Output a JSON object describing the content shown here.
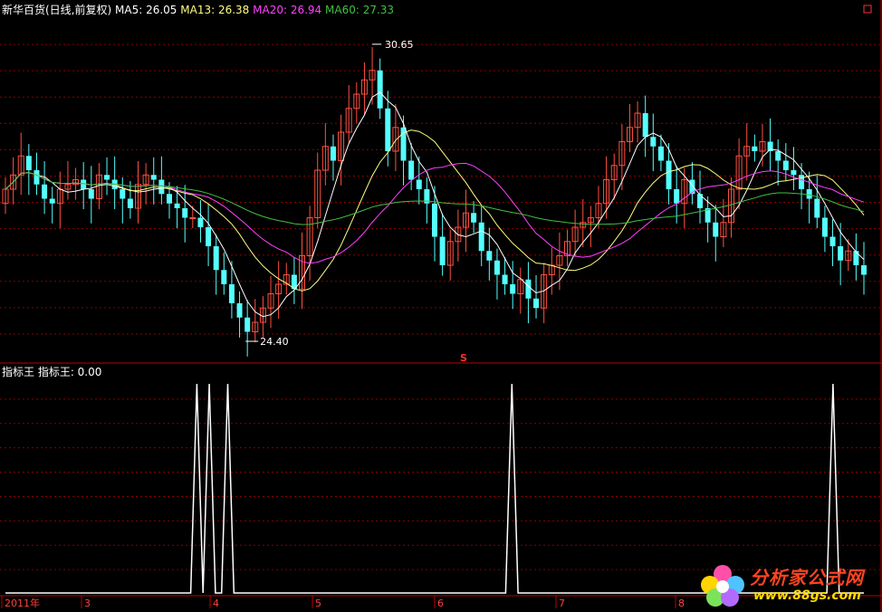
{
  "header": {
    "stock_label": "新华百货(日线,前复权)",
    "ma5_label": "MA5: 26.05",
    "ma13_label": "MA13: 26.38",
    "ma20_label": "MA20: 26.94",
    "ma60_label": "MA60: 27.33"
  },
  "indicator_header": {
    "label": "指标王  指标王: 0.00"
  },
  "annotations": {
    "high": "30.65",
    "low": "24.40",
    "signal_mark": "S"
  },
  "watermark": {
    "title": "分析家公式网",
    "url": "www.88gs.com"
  },
  "colors": {
    "background": "#000000",
    "candle_up": "#ff5040",
    "candle_down": "#54ffff",
    "ma5": "#ffffff",
    "ma13": "#ffff80",
    "ma20": "#ff40ff",
    "ma60": "#40c040",
    "grid": "#8b0000",
    "indicator_line": "#ffffff"
  },
  "chart_data": [
    {
      "type": "candlestick",
      "title": "新华百货(日线,前复权)",
      "x_axis_labels": [
        "2011年",
        "3",
        "4",
        "5",
        "6",
        "7",
        "8"
      ],
      "y_range": [
        24.0,
        31.2
      ],
      "high": 30.65,
      "low": 24.4,
      "close": [
        27.6,
        27.9,
        28.3,
        28.0,
        27.7,
        27.4,
        27.3,
        27.6,
        27.7,
        27.8,
        27.6,
        27.4,
        27.9,
        27.8,
        27.6,
        27.4,
        27.2,
        27.7,
        27.9,
        27.8,
        27.5,
        27.3,
        27.2,
        27.0,
        27.0,
        26.8,
        26.4,
        25.9,
        25.6,
        25.2,
        24.9,
        24.6,
        24.8,
        25.1,
        25.4,
        25.6,
        25.8,
        25.5,
        26.2,
        27.0,
        28.0,
        28.5,
        28.2,
        28.8,
        29.3,
        29.6,
        29.9,
        30.1,
        29.3,
        28.4,
        28.9,
        28.2,
        27.8,
        27.6,
        27.3,
        26.6,
        26.0,
        26.5,
        26.8,
        27.1,
        26.9,
        26.3,
        26.1,
        25.8,
        25.6,
        25.4,
        25.7,
        25.3,
        25.1,
        25.8,
        26.0,
        26.2,
        26.5,
        26.8,
        26.9,
        27.0,
        27.3,
        27.8,
        28.1,
        28.6,
        28.9,
        29.2,
        28.7,
        28.5,
        28.2,
        27.6,
        27.3,
        27.8,
        27.5,
        27.2,
        26.9,
        26.6,
        26.9,
        27.6,
        28.3,
        28.5,
        28.4,
        28.6,
        28.4,
        28.2,
        28.0,
        27.9,
        27.6,
        27.4,
        27.0,
        26.6,
        26.4,
        26.1,
        26.3,
        26.0,
        25.8
      ]
    },
    {
      "type": "line",
      "title": "指标王",
      "value": 0.0,
      "y_range": [
        0,
        1
      ],
      "spikes": [
        {
          "x_index": 31,
          "value": 1
        },
        {
          "x_index": 33,
          "value": 1
        },
        {
          "x_index": 36,
          "value": 1
        },
        {
          "x_index": 82,
          "value": 1
        },
        {
          "x_index": 134,
          "value": 1
        }
      ],
      "n_points": 140
    }
  ]
}
